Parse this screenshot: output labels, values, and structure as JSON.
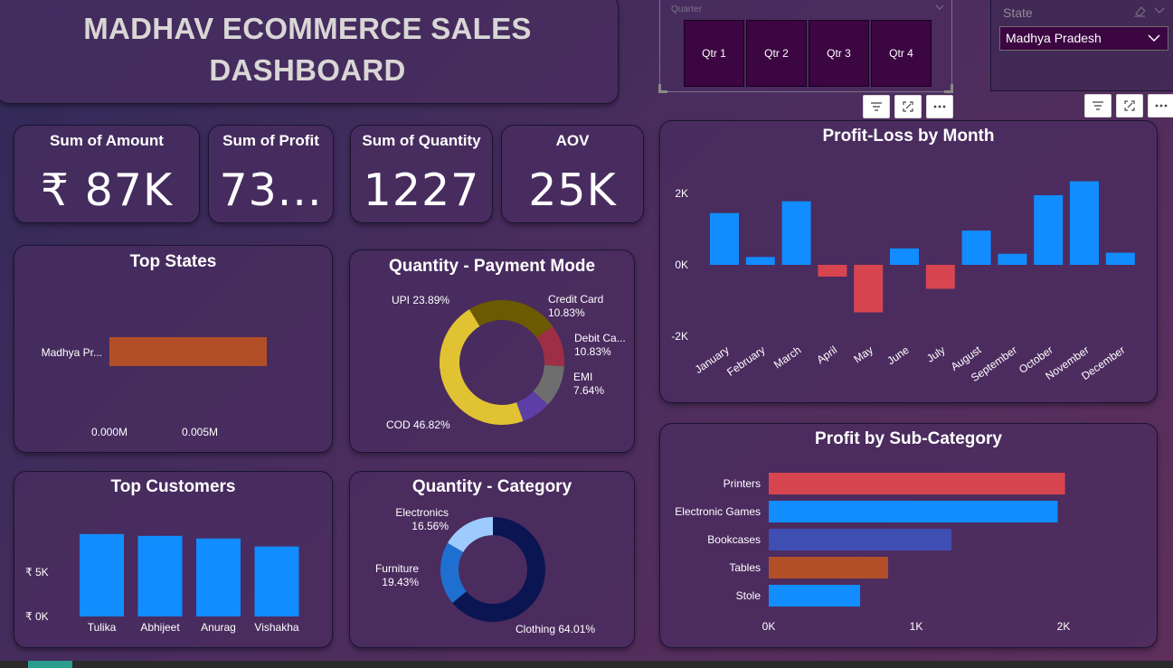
{
  "dashboard": {
    "title": "MADHAV ECOMMERCE SALES DASHBOARD"
  },
  "quarter_slicer": {
    "header": "Quarter",
    "options": [
      "Qtr 1",
      "Qtr 2",
      "Qtr 3",
      "Qtr 4"
    ]
  },
  "state_slicer": {
    "label": "State",
    "selected": "Madhya Pradesh"
  },
  "kpis": [
    {
      "label": "Sum of Amount",
      "value": "₹ 87K"
    },
    {
      "label": "Sum of Profit",
      "value": "73..."
    },
    {
      "label": "Sum of Quantity",
      "value": "1227"
    },
    {
      "label": "AOV",
      "value": "25K"
    }
  ],
  "colors": {
    "blue": "#118dff",
    "red": "#d64550",
    "orange": "#b24f28",
    "indigo": "#3f4eb3",
    "navy": "#0b1552",
    "mid_blue": "#1f6fd1",
    "light_blue": "#9ecbff",
    "olive": "#6b5a00",
    "crimson": "#9e2e45",
    "grey": "#6e6e6e",
    "purple": "#5d3ea6",
    "yellow": "#e1c233"
  },
  "icons": {
    "filter": "filter-icon",
    "focus": "focus-mode-icon",
    "more": "more-options-icon",
    "dropdown": "chevron-down-icon",
    "eraser": "eraser-icon"
  },
  "chart_data": [
    {
      "id": "top_states",
      "type": "bar",
      "orientation": "horizontal",
      "title": "Top States",
      "categories": [
        "Madhya Pr..."
      ],
      "values": [
        0.0087
      ],
      "unit": "M",
      "xticks": [
        "0.000M",
        "0.005M"
      ],
      "xlim": [
        0,
        0.01
      ],
      "bar_color": "#b24f28"
    },
    {
      "id": "payment_mode",
      "type": "pie",
      "donut": true,
      "title": "Quantity - Payment Mode",
      "slices": [
        {
          "label": "COD",
          "pct_label": "46.82%",
          "value": 46.82,
          "color": "#e1c233"
        },
        {
          "label": "UPI",
          "pct_label": "23.89%",
          "value": 23.89,
          "color": "#6b5a00"
        },
        {
          "label": "Credit Card",
          "pct_label": "10.83%",
          "value": 10.83,
          "color": "#9e2e45"
        },
        {
          "label": "Debit Ca...",
          "pct_label": "10.83%",
          "value": 10.83,
          "color": "#6e6e6e"
        },
        {
          "label": "EMI",
          "pct_label": "7.64%",
          "value": 7.64,
          "color": "#5d3ea6"
        }
      ]
    },
    {
      "id": "top_customers",
      "type": "bar",
      "title": "Top Customers",
      "categories": [
        "Tulika",
        "Abhijeet",
        "Anurag",
        "Vishakha"
      ],
      "values": [
        9300,
        9100,
        8800,
        7900
      ],
      "yticks": [
        "₹ 0K",
        "₹ 5K"
      ],
      "ylim": [
        0,
        10000
      ],
      "bar_color": "#118dff"
    },
    {
      "id": "category",
      "type": "pie",
      "donut": true,
      "title": "Quantity - Category",
      "slices": [
        {
          "label": "Clothing",
          "pct_label": "64.01%",
          "value": 64.01,
          "color": "#0b1552"
        },
        {
          "label": "Furniture",
          "pct_label": "19.43%",
          "value": 19.43,
          "color": "#1f6fd1"
        },
        {
          "label": "Electronics",
          "pct_label": "16.56%",
          "value": 16.56,
          "color": "#9ecbff"
        }
      ]
    },
    {
      "id": "profit_loss_month",
      "type": "bar",
      "title": "Profit-Loss by Month",
      "categories": [
        "January",
        "February",
        "March",
        "April",
        "May",
        "June",
        "July",
        "August",
        "September",
        "October",
        "November",
        "December"
      ],
      "values": [
        1450,
        220,
        1780,
        -330,
        -1330,
        460,
        -670,
        960,
        310,
        1950,
        2340,
        340
      ],
      "yticks": [
        "-2K",
        "0K",
        "2K"
      ],
      "ytick_values": [
        -2000,
        0,
        2000
      ],
      "ylim": [
        -2000,
        2000
      ],
      "positive_color": "#118dff",
      "negative_color": "#d64550"
    },
    {
      "id": "profit_subcategory",
      "type": "bar",
      "orientation": "horizontal",
      "title": "Profit by Sub-Category",
      "categories": [
        "Printers",
        "Electronic Games",
        "Bookcases",
        "Tables",
        "Stole"
      ],
      "values": [
        2010,
        1960,
        1240,
        810,
        620
      ],
      "colors": [
        "#d64550",
        "#118dff",
        "#3f4eb3",
        "#b24f28",
        "#118dff"
      ],
      "xticks": [
        "0K",
        "1K",
        "2K"
      ],
      "xtick_values": [
        0,
        1000,
        2000
      ],
      "xlim": [
        0,
        2000
      ]
    }
  ]
}
